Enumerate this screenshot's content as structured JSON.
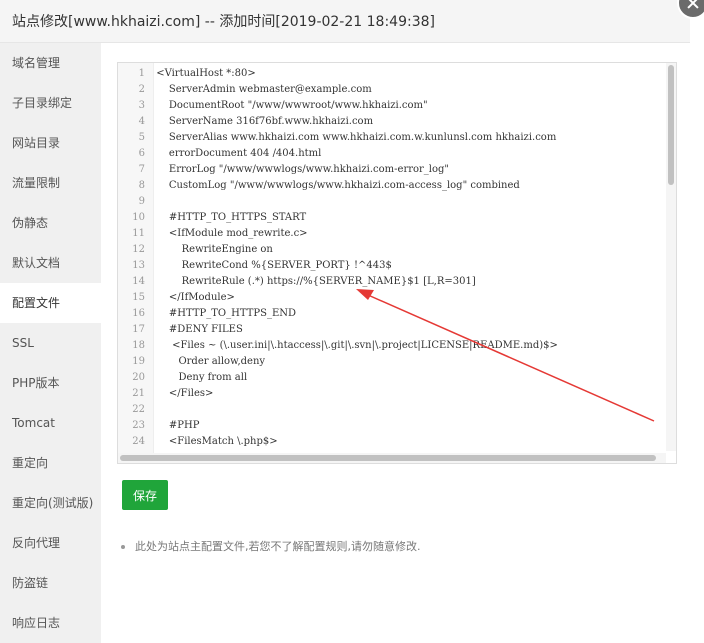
{
  "dialog": {
    "title": "站点修改[www.hkhaizi.com] -- 添加时间[2019-02-21 18:49:38]"
  },
  "sidebar": {
    "items": [
      {
        "label": "域名管理"
      },
      {
        "label": "子目录绑定"
      },
      {
        "label": "网站目录"
      },
      {
        "label": "流量限制"
      },
      {
        "label": "伪静态"
      },
      {
        "label": "默认文档"
      },
      {
        "label": "配置文件",
        "active": true
      },
      {
        "label": "SSL"
      },
      {
        "label": "PHP版本"
      },
      {
        "label": "Tomcat"
      },
      {
        "label": "重定向"
      },
      {
        "label": "重定向(测试版)"
      },
      {
        "label": "反向代理"
      },
      {
        "label": "防盗链"
      },
      {
        "label": "响应日志"
      }
    ]
  },
  "editor": {
    "lines": [
      {
        "n": "1",
        "t": "<VirtualHost *:80>"
      },
      {
        "n": "2",
        "t": "    ServerAdmin webmaster@example.com"
      },
      {
        "n": "3",
        "t": "    DocumentRoot \"/www/wwwroot/www.hkhaizi.com\""
      },
      {
        "n": "4",
        "t": "    ServerName 316f76bf.www.hkhaizi.com"
      },
      {
        "n": "5",
        "t": "    ServerAlias www.hkhaizi.com www.hkhaizi.com.w.kunlunsl.com hkhaizi.com"
      },
      {
        "n": "6",
        "t": "    errorDocument 404 /404.html"
      },
      {
        "n": "7",
        "t": "    ErrorLog \"/www/wwwlogs/www.hkhaizi.com-error_log\""
      },
      {
        "n": "8",
        "t": "    CustomLog \"/www/wwwlogs/www.hkhaizi.com-access_log\" combined"
      },
      {
        "n": "9",
        "t": ""
      },
      {
        "n": "10",
        "t": "    #HTTP_TO_HTTPS_START"
      },
      {
        "n": "11",
        "t": "    <IfModule mod_rewrite.c>"
      },
      {
        "n": "12",
        "t": "        RewriteEngine on"
      },
      {
        "n": "13",
        "t": "        RewriteCond %{SERVER_PORT} !^443$"
      },
      {
        "n": "14",
        "t": "        RewriteRule (.*) https://%{SERVER_NAME}$1 [L,R=301]"
      },
      {
        "n": "15",
        "t": "    </IfModule>"
      },
      {
        "n": "16",
        "t": "    #HTTP_TO_HTTPS_END"
      },
      {
        "n": "17",
        "t": "    #DENY FILES"
      },
      {
        "n": "18",
        "t": "     <Files ~ (\\.user.ini|\\.htaccess|\\.git|\\.svn|\\.project|LICENSE|README.md)$>"
      },
      {
        "n": "19",
        "t": "       Order allow,deny"
      },
      {
        "n": "20",
        "t": "       Deny from all"
      },
      {
        "n": "21",
        "t": "    </Files>"
      },
      {
        "n": "22",
        "t": ""
      },
      {
        "n": "23",
        "t": "    #PHP"
      },
      {
        "n": "24",
        "t": "    <FilesMatch \\.php$>"
      }
    ]
  },
  "actions": {
    "save_label": "保存"
  },
  "tips": {
    "config_tip": "此处为站点主配置文件,若您不了解配置规则,请勿随意修改."
  },
  "colors": {
    "accent": "#20a53a",
    "arrow": "#e53935"
  },
  "icons": {
    "close": "close-icon"
  }
}
